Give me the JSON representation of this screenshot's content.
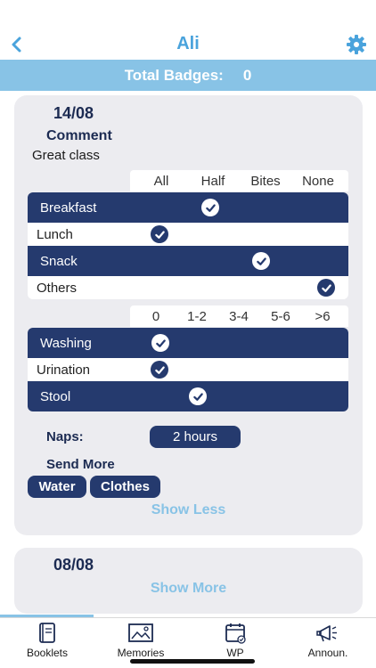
{
  "header": {
    "title": "Ali",
    "back_icon": "chevron-left-icon",
    "settings_icon": "gear-icon"
  },
  "badges": {
    "label": "Total Badges:",
    "count": "0"
  },
  "entries": [
    {
      "date": "14/08",
      "comment_label": "Comment",
      "comment": "Great class",
      "meals": {
        "columns": [
          "All",
          "Half",
          "Bites",
          "None"
        ],
        "rows": [
          {
            "label": "Breakfast",
            "selected": "Half"
          },
          {
            "label": "Lunch",
            "selected": "All"
          },
          {
            "label": "Snack",
            "selected": "Bites"
          },
          {
            "label": "Others",
            "selected": "None"
          }
        ]
      },
      "hygiene": {
        "columns": [
          "0",
          "1-2",
          "3-4",
          "5-6",
          ">6"
        ],
        "rows": [
          {
            "label": "Washing",
            "selected": "0"
          },
          {
            "label": "Urination",
            "selected": "0"
          },
          {
            "label": "Stool",
            "selected": "1-2"
          }
        ]
      },
      "naps_label": "Naps:",
      "naps_value": "2 hours",
      "send_more_label": "Send More",
      "send_more_items": [
        "Water",
        "Clothes"
      ],
      "toggle_label": "Show Less"
    },
    {
      "date": "08/08",
      "toggle_label": "Show More"
    }
  ],
  "tabs": [
    {
      "label": "Booklets",
      "icon": "booklet-icon"
    },
    {
      "label": "Memories",
      "icon": "photo-icon"
    },
    {
      "label": "WP",
      "icon": "calendar-icon"
    },
    {
      "label": "Announ.",
      "icon": "megaphone-icon"
    }
  ],
  "colors": {
    "accent": "#4aa3dc",
    "light_accent": "#88c3e6",
    "navy": "#253a6e",
    "card": "#ececf0"
  }
}
